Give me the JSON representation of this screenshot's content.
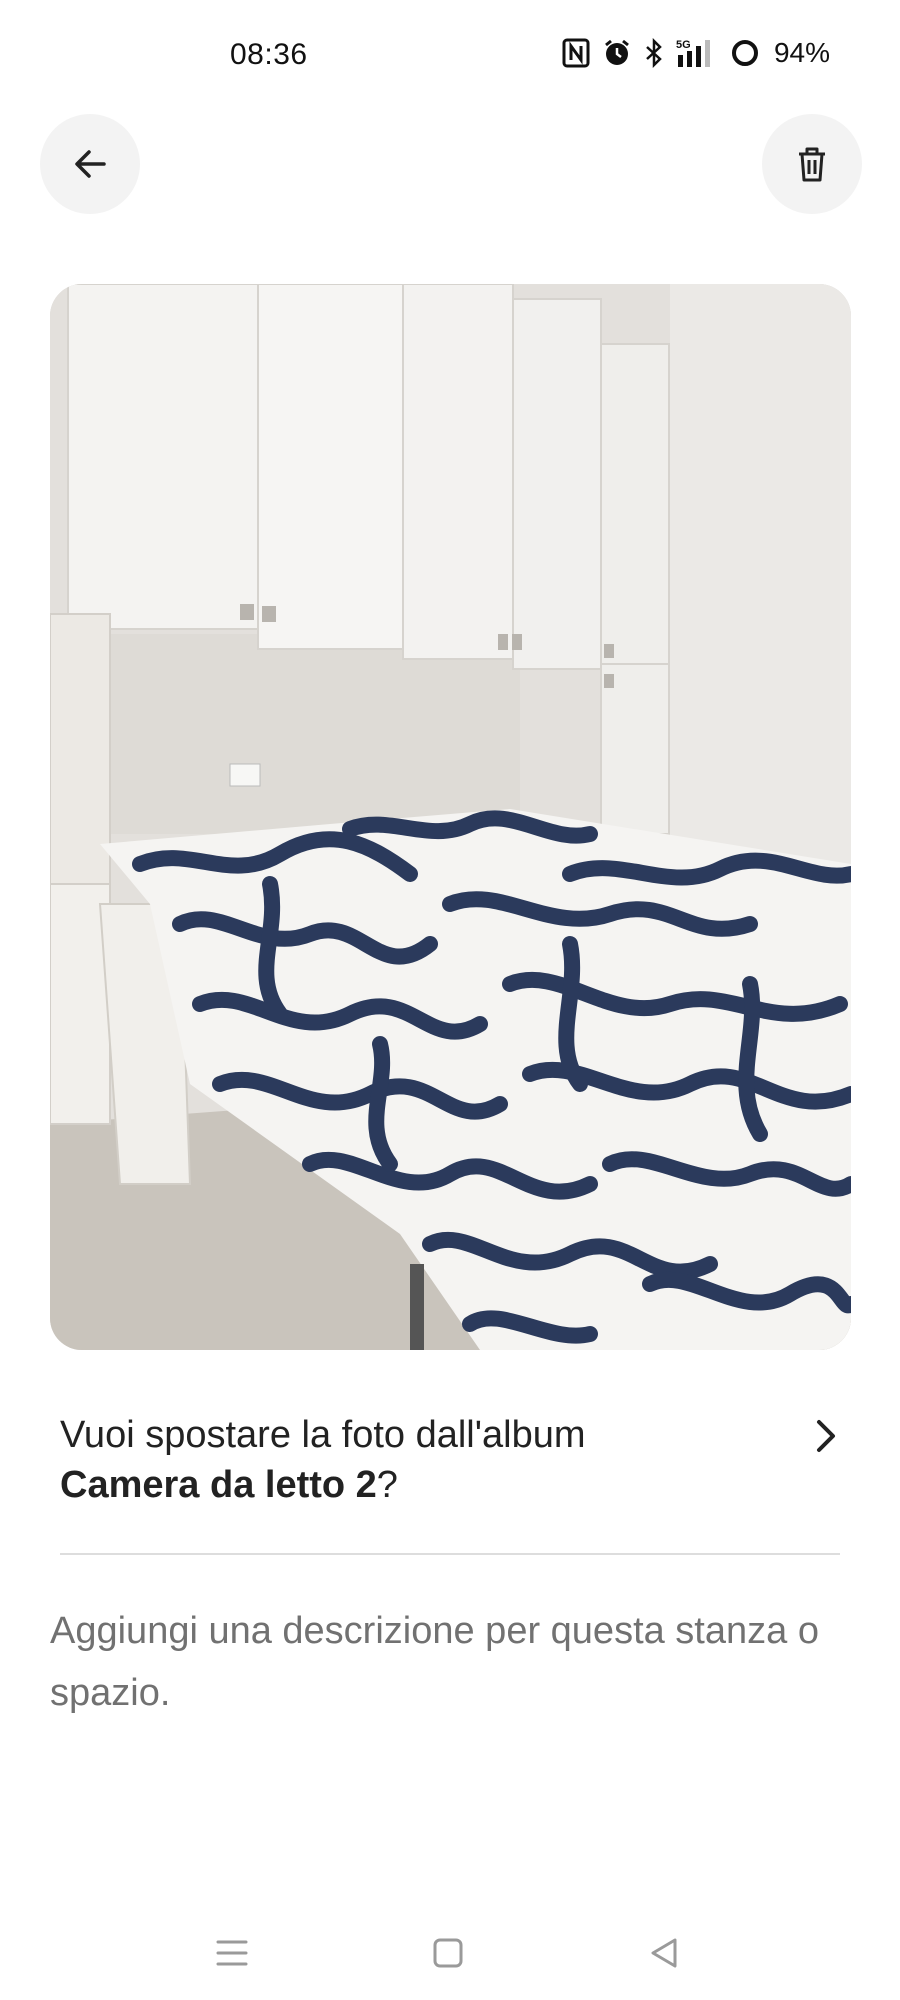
{
  "status_bar": {
    "time": "08:36",
    "network": "5G",
    "battery": "94%",
    "icons": [
      "nfc-icon",
      "alarm-icon",
      "bluetooth-icon",
      "signal-5g-icon",
      "battery-icon"
    ]
  },
  "header": {
    "back_icon": "arrow-left-icon",
    "delete_icon": "trash-icon"
  },
  "photo": {
    "subject": "bedroom-photo"
  },
  "album_prompt": {
    "text": "Vuoi spostare la foto dall'album",
    "album_name": "Camera da letto 2",
    "suffix": "?",
    "chevron_icon": "chevron-right-icon"
  },
  "description": {
    "placeholder": "Aggiungi una descrizione per questa stanza o spazio."
  },
  "nav_bar": {
    "icons": [
      "menu-icon",
      "home-square-icon",
      "back-triangle-icon"
    ]
  },
  "colors": {
    "button_bg": "#f3f3f3",
    "text_primary": "#222222",
    "text_secondary": "#717171",
    "divider": "#dddddd",
    "duvet_pattern": "#2b3a5c"
  }
}
